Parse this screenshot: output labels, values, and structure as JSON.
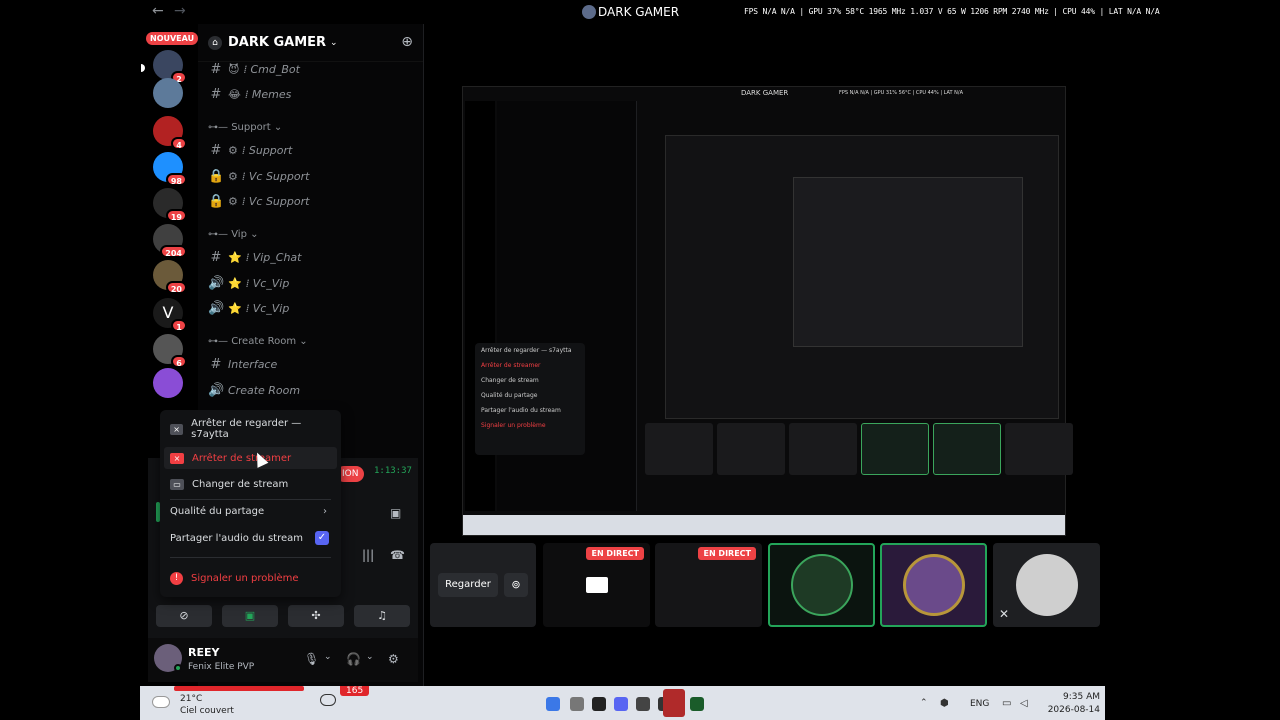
{
  "titlebar": {
    "title": "DARK GAMER",
    "stats": "FPS N/A N/A | GPU 37% 58°C 1965 MHz 1.037 V 65 W 1206 RPM 2740 MHz | CPU 44% | LAT N/A N/A"
  },
  "rail": {
    "nouveau_label": "NOUVEAU",
    "badges": [
      "2",
      "4",
      "98",
      "19",
      "204",
      "20",
      "1",
      "6"
    ]
  },
  "server": {
    "name": "DARK GAMER",
    "channels": [
      {
        "icon": "hash",
        "emoji": "😈",
        "name": "⁞ Cmd_Bot"
      },
      {
        "icon": "hash",
        "emoji": "😂",
        "name": "⁞ Memes"
      }
    ],
    "cat_support": "Support",
    "support_channels": [
      {
        "name": "⁞ Support"
      },
      {
        "name": "⁞ Vc Support"
      },
      {
        "name": "⁞ Vc Support"
      }
    ],
    "cat_vip": "Vip",
    "vip_channels": [
      {
        "name": "⁞ Vip_Chat"
      },
      {
        "name": "⁞ Vc_Vip"
      },
      {
        "name": "⁞ Vc_Vip"
      }
    ],
    "cat_room": "Create Room",
    "room_channels": [
      {
        "name": "Interface"
      },
      {
        "name": "Create Room"
      }
    ]
  },
  "voice": {
    "live_label": "ION",
    "timer": "1:13:37"
  },
  "menu": {
    "stop_watching": "Arrêter de regarder — s7aytta",
    "stop_streaming": "Arrêter de streamer",
    "change_stream": "Changer de stream",
    "quality": "Qualité du partage",
    "share_audio": "Partager l'audio du stream",
    "report": "Signaler un problème"
  },
  "user": {
    "name": "REEY",
    "status": "Fenix Elite PVP"
  },
  "stage": {
    "watch_label": "Regarder",
    "live_label": "EN DIRECT",
    "nested_title": "DARK GAMER",
    "nested_stats": "FPS N/A N/A | GPU 31% 56°C | CPU 44% | LAT N/A"
  },
  "taskbar": {
    "temp": "21°C",
    "sky": "Ciel couvert",
    "badge": "165",
    "lang": "ENG",
    "time": "9:35 AM",
    "date": "2026-08-14"
  }
}
